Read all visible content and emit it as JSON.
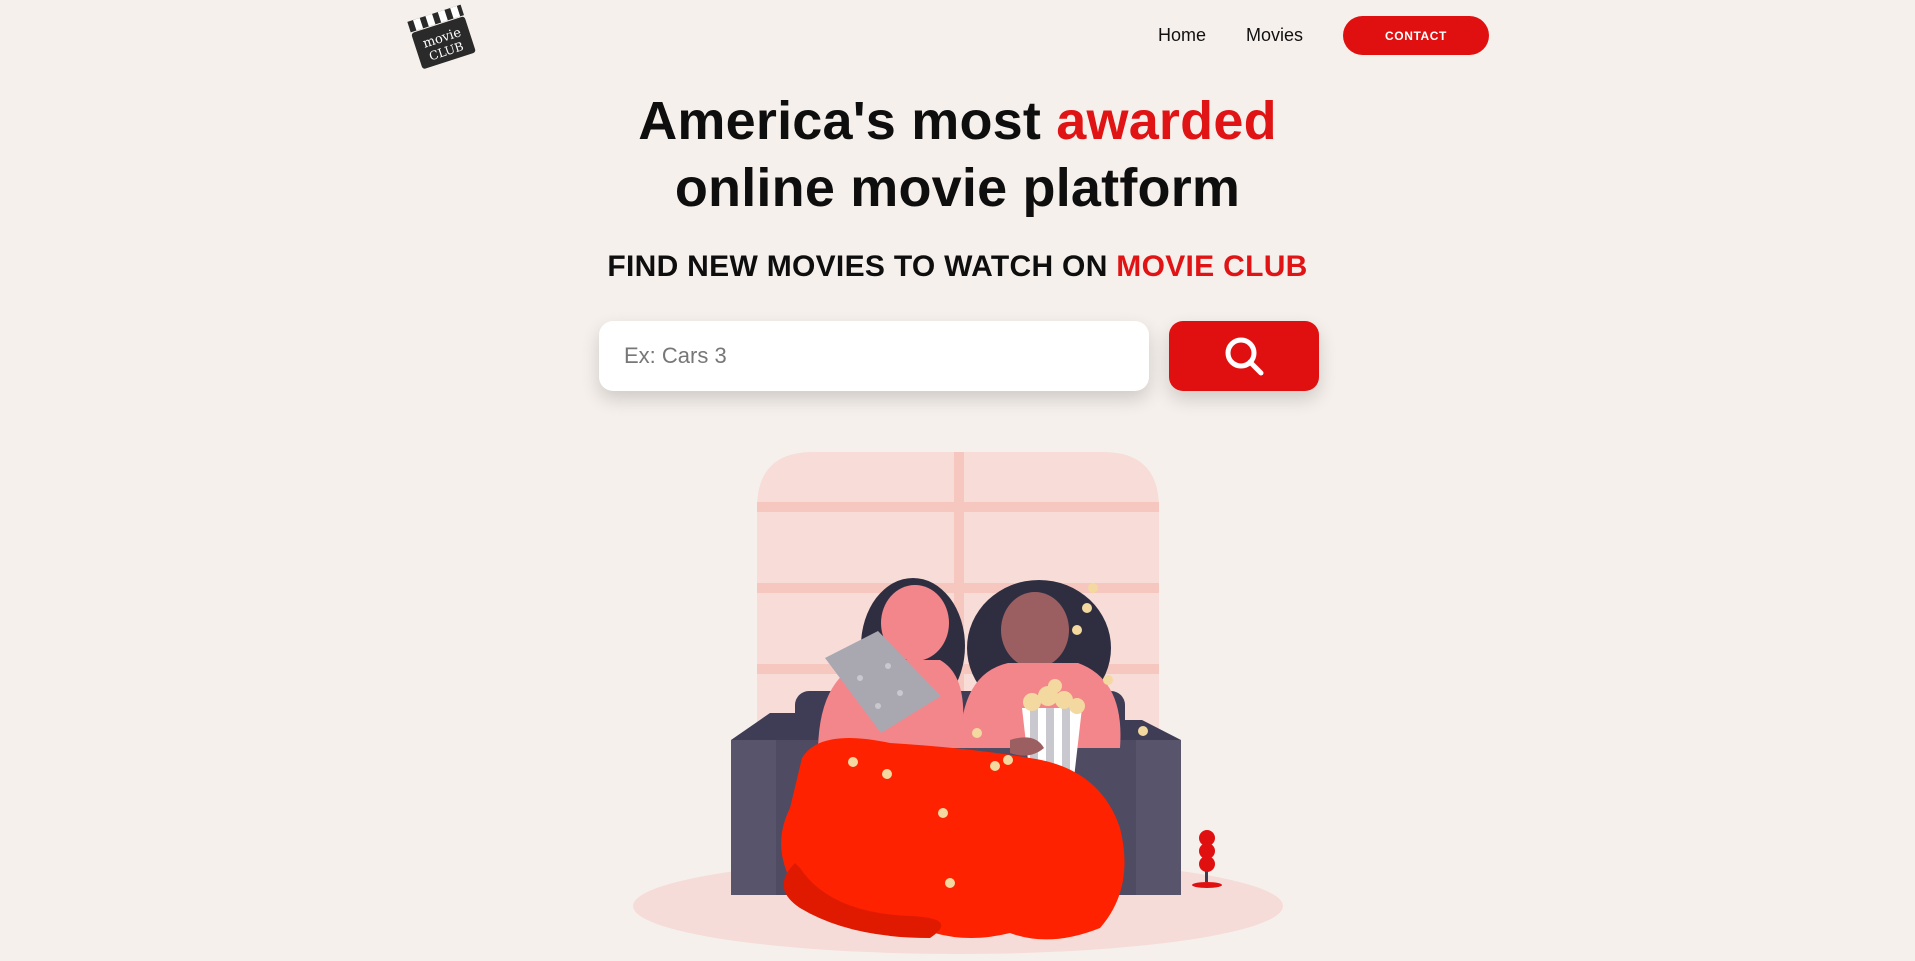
{
  "header": {
    "logo_text_top": "movie",
    "logo_text_bottom": "CLUB",
    "nav": [
      {
        "label": "Home"
      },
      {
        "label": "Movies"
      }
    ],
    "contact_label": "CONTACT"
  },
  "hero": {
    "title_part1": "America's most ",
    "title_highlight": "awarded",
    "title_line2": "online movie platform",
    "subtitle_part1": "FIND NEW MOVIES TO WATCH ON ",
    "subtitle_highlight": "MOVIE CLUB"
  },
  "search": {
    "placeholder": "Ex: Cars 3",
    "value": "",
    "icon": "search-icon"
  },
  "illustration": {
    "subject": "two-women-watching-movie-on-couch"
  },
  "colors": {
    "accent": "#e01010",
    "background": "#f6f0ec"
  }
}
